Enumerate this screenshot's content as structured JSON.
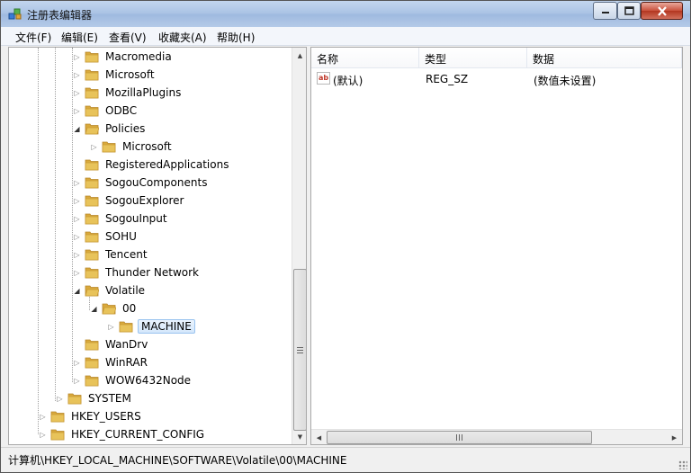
{
  "window": {
    "title": "注册表编辑器"
  },
  "menu": [
    "文件(F)",
    "编辑(E)",
    "查看(V)",
    "收藏夹(A)",
    "帮助(H)"
  ],
  "tree": {
    "items": [
      {
        "label": "Macromedia",
        "expander": "closed"
      },
      {
        "label": "Microsoft",
        "expander": "closed"
      },
      {
        "label": "MozillaPlugins",
        "expander": "closed"
      },
      {
        "label": "ODBC",
        "expander": "closed"
      },
      {
        "label": "Policies",
        "expander": "open"
      },
      {
        "label": "Microsoft",
        "expander": "closed"
      },
      {
        "label": "RegisteredApplications",
        "expander": "none"
      },
      {
        "label": "SogouComponents",
        "expander": "closed"
      },
      {
        "label": "SogouExplorer",
        "expander": "closed"
      },
      {
        "label": "SogouInput",
        "expander": "closed"
      },
      {
        "label": "SOHU",
        "expander": "closed"
      },
      {
        "label": "Tencent",
        "expander": "closed"
      },
      {
        "label": "Thunder Network",
        "expander": "closed"
      },
      {
        "label": "Volatile",
        "expander": "open"
      },
      {
        "label": "00",
        "expander": "open"
      },
      {
        "label": "MACHINE",
        "expander": "closed",
        "selected": true
      },
      {
        "label": "WanDrv",
        "expander": "none"
      },
      {
        "label": "WinRAR",
        "expander": "closed"
      },
      {
        "label": "WOW6432Node",
        "expander": "closed"
      },
      {
        "label": "SYSTEM",
        "expander": "closed"
      },
      {
        "label": "HKEY_USERS",
        "expander": "closed"
      },
      {
        "label": "HKEY_CURRENT_CONFIG",
        "expander": "closed"
      }
    ]
  },
  "list": {
    "columns": [
      "名称",
      "类型",
      "数据"
    ],
    "rows": [
      {
        "name": "(默认)",
        "type": "REG_SZ",
        "data": "(数值未设置)",
        "icon": "string-value-icon"
      }
    ]
  },
  "status": {
    "path": "计算机\\HKEY_LOCAL_MACHINE\\SOFTWARE\\Volatile\\00\\MACHINE"
  },
  "colors": {
    "selection": "#d4e7fb",
    "selection_border": "#99c3ef",
    "titlebar": "#b4cae8",
    "folder": "#e8c35a"
  }
}
